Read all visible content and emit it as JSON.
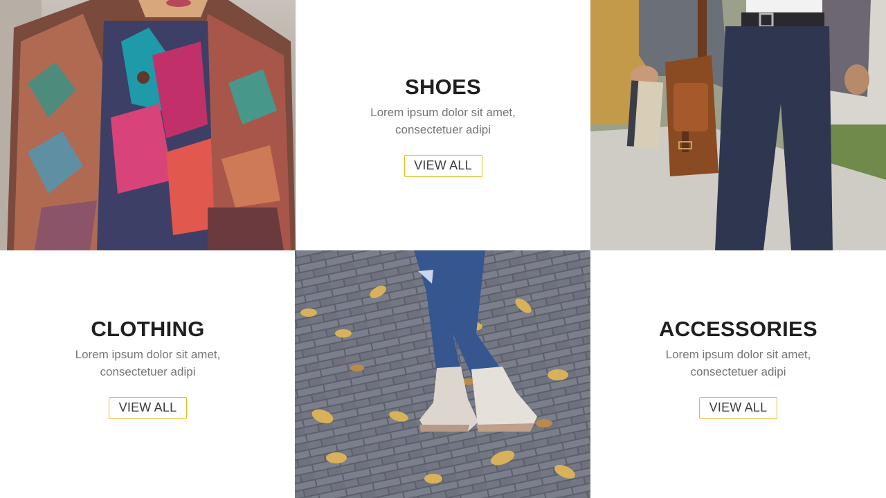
{
  "panels": {
    "shoes": {
      "title": "SHOES",
      "line1": "Lorem ipsum dolor sit amet,",
      "line2": "consectetuer adipi",
      "button": "VIEW ALL"
    },
    "clothing": {
      "title": "CLOTHING",
      "line1": "Lorem ipsum dolor sit amet,",
      "line2": "consectetuer adipi",
      "button": "VIEW ALL"
    },
    "accessories": {
      "title": "ACCESSORIES",
      "line1": "Lorem ipsum dolor sit amet,",
      "line2": "consectetuer adipi",
      "button": "VIEW ALL"
    }
  },
  "colors": {
    "button_border": "#e8b923",
    "title": "#1f1f1f",
    "body_text": "#757575"
  },
  "photos": [
    "colorful-poncho-photo",
    "man-with-leather-bag-photo",
    "white-boots-on-pavement-photo"
  ]
}
